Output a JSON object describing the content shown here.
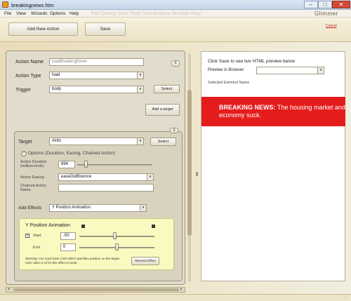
{
  "window": {
    "title": "breakingnews.htm",
    "controls": {
      "minimize": "–",
      "maximize": "□",
      "close": "✕"
    },
    "icon": "app-icon"
  },
  "menu": {
    "items": [
      "File",
      "View",
      "Wizards",
      "Options",
      "Help"
    ],
    "ghost_items": "Edit   Debug   Data   Tools   Test   Analyze   Window   Help",
    "brand": "Glimmer"
  },
  "toolbar": {
    "add_new_action": "Add New Action",
    "save": "Save",
    "cancel": "Cancel"
  },
  "action_form": {
    "action_name_label": "Action Name",
    "action_name_value": "loadBreakingNews",
    "action_type_label": "Action Type",
    "action_type_value": "load",
    "trigger_label": "Trigger",
    "trigger_value": "body",
    "close_button": "X",
    "select_button": "Select",
    "add_target_button": "Add a target"
  },
  "target": {
    "close_button": "X",
    "target_label": "Target",
    "target_value": "#info",
    "select_button": "Select",
    "options_toggle": "^",
    "options_label": "Options (Duration, Easing, Chained Action)",
    "duration_label": "Action Duration (milliseconds)",
    "duration_value": "894",
    "duration_fraction": 0.12,
    "easing_label": "Action Easing",
    "easing_value": "easeOutBounce",
    "chained_label": "Chained Action Name",
    "chained_value": "",
    "add_effects_label": "Add Effects",
    "add_effects_value": "Y Position Animation"
  },
  "effect": {
    "title": "Y Position Animation",
    "start_label": "Start",
    "start_checked": "✓",
    "start_value": "-50",
    "start_fraction": 0.48,
    "end_label": "End",
    "end_value": "0",
    "end_fraction": 0.5,
    "warning": "Warning: You must have CSS which specifies position on the target CSS class or id for this effect to work.",
    "remove_button": "Remove Effect"
  },
  "preview": {
    "hint": "Click Save to see live HTML preview below",
    "preview_in_browser_label": "Preview in Browser",
    "preview_in_browser_value": "",
    "selected_element_label": "Selected Element Name",
    "news_bold": "BREAKING NEWS:",
    "news_text": " The housing market and",
    "news_text_line2": "economy suck."
  },
  "colors": {
    "accent_red": "#e51c1c",
    "effect_bg": "#fafac0",
    "workspace_bg": "#efe6cc"
  }
}
